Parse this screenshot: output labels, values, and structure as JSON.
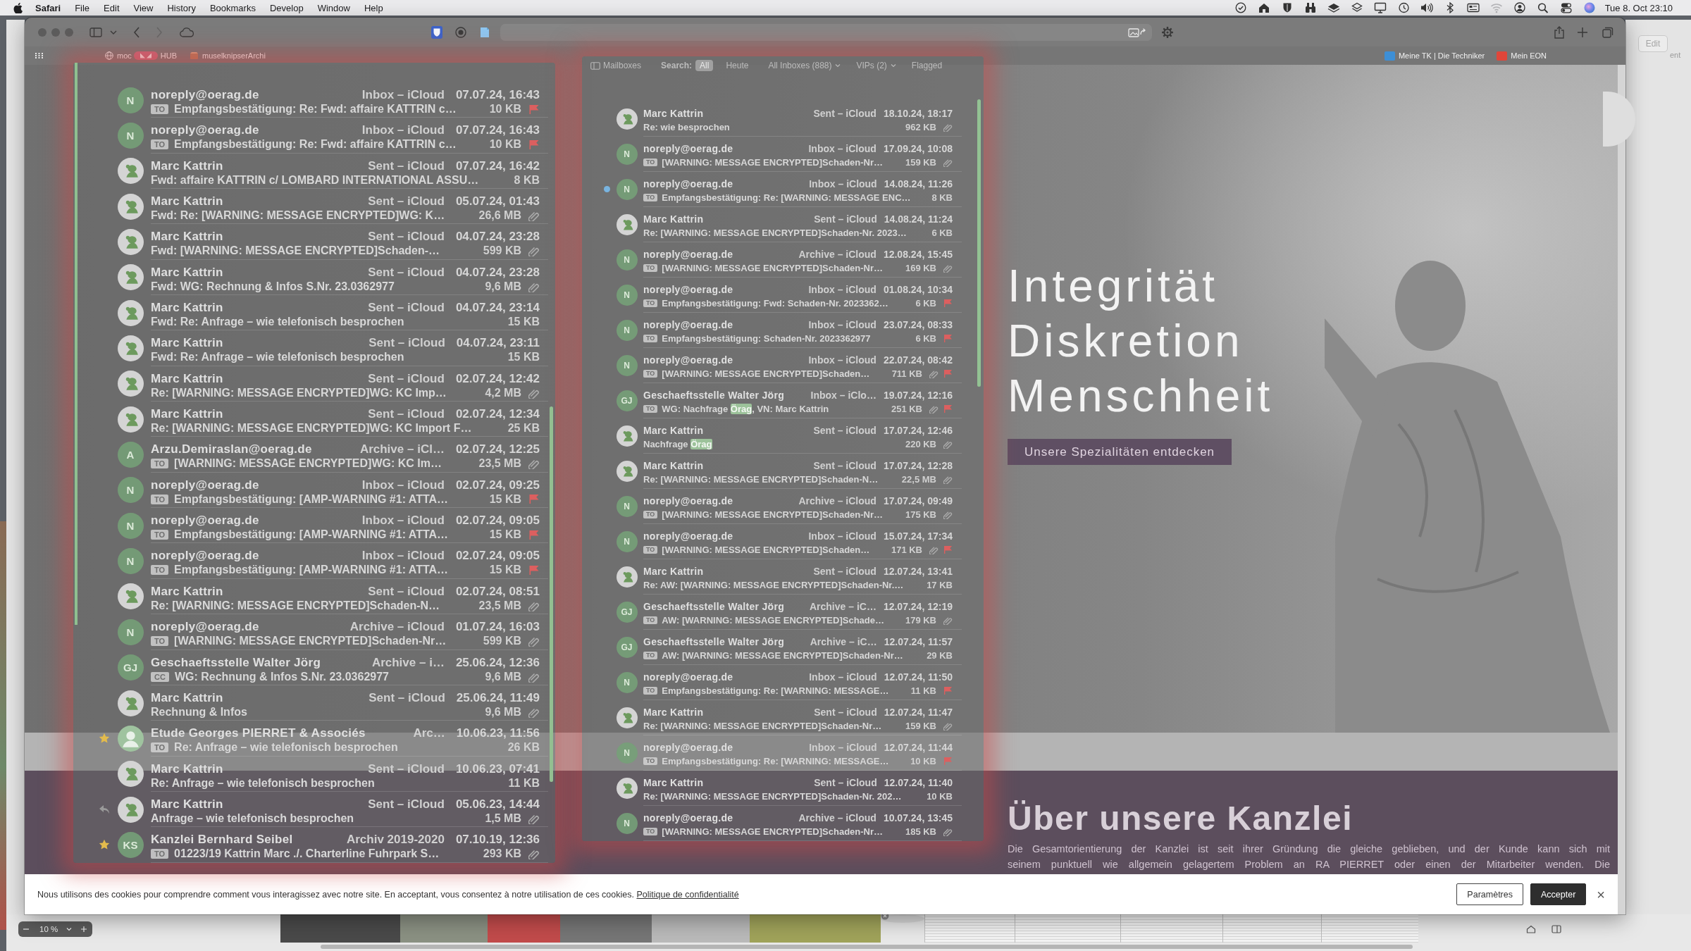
{
  "menu_bar": {
    "app": "Safari",
    "menus": [
      "File",
      "Edit",
      "View",
      "History",
      "Bookmarks",
      "Develop",
      "Window",
      "Help"
    ],
    "clock": "Tue 8. Oct 23:10"
  },
  "safari": {
    "favorites_left": [
      {
        "kind": "globe",
        "label": "moc",
        "suffix": "HUB"
      },
      {
        "kind": "box",
        "label": "muselknipserArchi"
      }
    ],
    "favorites_right": [
      {
        "kind": "tile",
        "label": "Meine TK | Die Techniker",
        "color": "#3d8fd6"
      },
      {
        "kind": "tile",
        "label": "Mein EON",
        "color": "#e0463a"
      }
    ]
  },
  "website": {
    "hero": {
      "lines": [
        "Integrität",
        "Diskretion",
        "Menschheit"
      ],
      "button": "Unsere Spezialitäten entdecken"
    },
    "about": {
      "heading": "Über unsere Kanzlei",
      "lines": [
        "Die Gesamtorientierung der Kanzlei ist seit ihrer Gründung die gleiche geblieben, und der Kunde kann sich mit",
        "seinem punktuell wie allgemein gelagertem Problem an RA PIERRET oder einen der Mitarbeiter wenden. Die"
      ]
    },
    "cookie_banner": {
      "text": "Nous utilisons des cookies pour comprendre comment vous interagissez avec notre site. En acceptant, vous consentez à notre utilisation de ces cookies.",
      "link": "Politique de confidentialité",
      "buttons": [
        {
          "label": "Paramètres",
          "kind": "outline"
        },
        {
          "label": "Accepter",
          "kind": "filled"
        }
      ],
      "close": "×"
    }
  },
  "mail_left": {
    "rows": [
      {
        "avatar": {
          "kind": "initials",
          "text": "N"
        },
        "sender": "noreply@oerag.de",
        "mailbox": "Inbox – iCloud",
        "date": "07.07.24, 16:43",
        "tag": "TO",
        "subject": "Empfangsbestätigung: Re: Fwd: affaire KATTRIN c…",
        "size": "10 KB",
        "attachment": false,
        "flagged": true
      },
      {
        "avatar": {
          "kind": "initials",
          "text": "N"
        },
        "sender": "noreply@oerag.de",
        "mailbox": "Inbox – iCloud",
        "date": "07.07.24, 16:43",
        "tag": "TO",
        "subject": "Empfangsbestätigung: Re: Fwd: affaire KATTRIN c…",
        "size": "10 KB",
        "attachment": false,
        "flagged": true
      },
      {
        "avatar": {
          "kind": "picture"
        },
        "sender": "Marc Kattrin",
        "mailbox": "Sent – iCloud",
        "date": "07.07.24, 16:42",
        "subject": "Fwd: affaire KATTRIN c/ LOMBARD INTERNATIONAL ASSU…",
        "size": "8 KB",
        "attachment": false,
        "flagged": false
      },
      {
        "avatar": {
          "kind": "picture"
        },
        "sender": "Marc Kattrin",
        "mailbox": "Sent – iCloud",
        "date": "05.07.24, 01:43",
        "subject": "Fwd: Re: [WARNING: MESSAGE ENCRYPTED]WG: K…",
        "size": "26,6 MB",
        "attachment": true,
        "flagged": false
      },
      {
        "avatar": {
          "kind": "picture"
        },
        "sender": "Marc Kattrin",
        "mailbox": "Sent – iCloud",
        "date": "04.07.24, 23:28",
        "subject": "Fwd: [WARNING: MESSAGE ENCRYPTED]Schaden-…",
        "size": "599 KB",
        "attachment": true,
        "flagged": false
      },
      {
        "avatar": {
          "kind": "picture"
        },
        "sender": "Marc Kattrin",
        "mailbox": "Sent – iCloud",
        "date": "04.07.24, 23:28",
        "subject": "Fwd: WG: Rechnung & Infos S.Nr. 23.0362977",
        "size": "9,6 MB",
        "attachment": true,
        "flagged": false
      },
      {
        "avatar": {
          "kind": "picture"
        },
        "sender": "Marc Kattrin",
        "mailbox": "Sent – iCloud",
        "date": "04.07.24, 23:14",
        "subject": "Fwd: Re: Anfrage – wie telefonisch besprochen",
        "size": "15 KB",
        "attachment": false,
        "flagged": false
      },
      {
        "avatar": {
          "kind": "picture"
        },
        "sender": "Marc Kattrin",
        "mailbox": "Sent – iCloud",
        "date": "04.07.24, 23:11",
        "subject": "Fwd: Re: Anfrage – wie telefonisch besprochen",
        "size": "15 KB",
        "attachment": false,
        "flagged": false
      },
      {
        "avatar": {
          "kind": "picture"
        },
        "sender": "Marc Kattrin",
        "mailbox": "Sent – iCloud",
        "date": "02.07.24, 12:42",
        "subject": "Re: [WARNING: MESSAGE ENCRYPTED]WG: KC Imp…",
        "size": "4,2 MB",
        "attachment": true,
        "flagged": false
      },
      {
        "avatar": {
          "kind": "picture"
        },
        "sender": "Marc Kattrin",
        "mailbox": "Sent – iCloud",
        "date": "02.07.24, 12:34",
        "subject": "Re: [WARNING: MESSAGE ENCRYPTED]WG: KC Import F…",
        "size": "25 KB",
        "attachment": false,
        "flagged": false
      },
      {
        "avatar": {
          "kind": "initials",
          "text": "A"
        },
        "sender": "Arzu.Demiraslan@oerag.de",
        "mailbox": "Archive – iCl…",
        "date": "02.07.24, 12:25",
        "tag": "TO",
        "subject": "[WARNING: MESSAGE ENCRYPTED]WG: KC Im…",
        "size": "23,5 MB",
        "attachment": true,
        "flagged": false
      },
      {
        "avatar": {
          "kind": "initials",
          "text": "N"
        },
        "sender": "noreply@oerag.de",
        "mailbox": "Inbox – iCloud",
        "date": "02.07.24, 09:25",
        "tag": "TO",
        "subject": "Empfangsbestätigung: [AMP-WARNING #1: ATTA…",
        "size": "15 KB",
        "attachment": false,
        "flagged": true
      },
      {
        "avatar": {
          "kind": "initials",
          "text": "N"
        },
        "sender": "noreply@oerag.de",
        "mailbox": "Inbox – iCloud",
        "date": "02.07.24, 09:05",
        "tag": "TO",
        "subject": "Empfangsbestätigung: [AMP-WARNING #1: ATTA…",
        "size": "15 KB",
        "attachment": false,
        "flagged": true
      },
      {
        "avatar": {
          "kind": "initials",
          "text": "N"
        },
        "sender": "noreply@oerag.de",
        "mailbox": "Inbox – iCloud",
        "date": "02.07.24, 09:05",
        "tag": "TO",
        "subject": "Empfangsbestätigung: [AMP-WARNING #1: ATTA…",
        "size": "15 KB",
        "attachment": false,
        "flagged": true
      },
      {
        "avatar": {
          "kind": "picture"
        },
        "sender": "Marc Kattrin",
        "mailbox": "Sent – iCloud",
        "date": "02.07.24, 08:51",
        "subject": "Re: [WARNING: MESSAGE ENCRYPTED]Schaden-N…",
        "size": "23,5 MB",
        "attachment": true,
        "flagged": false
      },
      {
        "avatar": {
          "kind": "initials",
          "text": "N"
        },
        "sender": "noreply@oerag.de",
        "mailbox": "Archive – iCloud",
        "date": "01.07.24, 16:03",
        "tag": "TO",
        "subject": "[WARNING: MESSAGE ENCRYPTED]Schaden-Nr…",
        "size": "599 KB",
        "attachment": true,
        "flagged": false
      },
      {
        "avatar": {
          "kind": "initials",
          "text": "GJ"
        },
        "sender": "Geschaeftsstelle Walter Jörg",
        "mailbox": "Archive – i…",
        "date": "25.06.24, 12:36",
        "tag": "CC",
        "subject": "WG: Rechnung & Infos S.Nr. 23.0362977",
        "size": "9,6 MB",
        "attachment": true,
        "flagged": false
      },
      {
        "avatar": {
          "kind": "picture"
        },
        "sender": "Marc Kattrin",
        "mailbox": "Sent – iCloud",
        "date": "25.06.24, 11:49",
        "subject": "Rechnung & Infos",
        "size": "9,6 MB",
        "attachment": true,
        "flagged": false
      },
      {
        "marker": {
          "kind": "star"
        },
        "avatar": {
          "kind": "person"
        },
        "sender": "Etude Georges PIERRET & Associés",
        "mailbox": "Arc…",
        "date": "10.06.23, 11:56",
        "tag": "TO",
        "subject": "Re: Anfrage – wie telefonisch besprochen",
        "size": "26 KB",
        "attachment": false,
        "flagged": false
      },
      {
        "avatar": {
          "kind": "picture"
        },
        "sender": "Marc Kattrin",
        "mailbox": "Sent – iCloud",
        "date": "10.06.23, 07:41",
        "subject": "Re: Anfrage – wie telefonisch besprochen",
        "size": "11 KB",
        "attachment": false,
        "flagged": false
      },
      {
        "marker": {
          "kind": "reply"
        },
        "avatar": {
          "kind": "picture"
        },
        "sender": "Marc Kattrin",
        "mailbox": "Sent – iCloud",
        "date": "05.06.23, 14:44",
        "subject": "Anfrage – wie telefonisch besprochen",
        "size": "1,5 MB",
        "attachment": true,
        "flagged": false
      },
      {
        "marker": {
          "kind": "star"
        },
        "avatar": {
          "kind": "initials",
          "text": "KS"
        },
        "sender": "Kanzlei Bernhard Seibel",
        "mailbox": "Archiv 2019-2020",
        "date": "07.10.19, 12:36",
        "tag": "TO",
        "subject": "01223/19 Kattrin Marc ./. Charterline Fuhrpark S…",
        "size": "293 KB",
        "attachment": true,
        "flagged": false
      }
    ]
  },
  "mail_right": {
    "sidebar_button": "Mailboxes",
    "search_label": "Search:",
    "search_scopes": [
      {
        "label": "All",
        "selected": true
      },
      {
        "label": "Heute",
        "selected": false
      }
    ],
    "filters": [
      {
        "label": "All Inboxes (888)",
        "menu": true
      },
      {
        "label": "VIPs (2)",
        "menu": true
      },
      {
        "label": "Flagged",
        "menu": false
      }
    ],
    "rows": [
      {
        "avatar": {
          "kind": "picture"
        },
        "sender": "Marc Kattrin",
        "mailbox": "Sent – iCloud",
        "date": "18.10.24, 18:17",
        "subject": "Re: wie besprochen",
        "size": "962 KB",
        "attachment": true,
        "flagged": false
      },
      {
        "avatar": {
          "kind": "initials",
          "text": "N"
        },
        "sender": "noreply@oerag.de",
        "mailbox": "Inbox – iCloud",
        "date": "17.09.24, 10:08",
        "tag": "TO",
        "subject": "[WARNING: MESSAGE ENCRYPTED]Schaden-Nr…",
        "size": "159 KB",
        "attachment": true,
        "flagged": false
      },
      {
        "marker": {
          "kind": "unread"
        },
        "avatar": {
          "kind": "initials",
          "text": "N"
        },
        "sender": "noreply@oerag.de",
        "mailbox": "Inbox – iCloud",
        "date": "14.08.24, 11:26",
        "tag": "TO",
        "subject": "Empfangsbestätigung: Re: [WARNING: MESSAGE ENC…",
        "size": "8 KB",
        "attachment": false,
        "flagged": false
      },
      {
        "avatar": {
          "kind": "picture"
        },
        "sender": "Marc Kattrin",
        "mailbox": "Sent – iCloud",
        "date": "14.08.24, 11:24",
        "subject": "Re: [WARNING: MESSAGE ENCRYPTED]Schaden-Nr. 2023…",
        "size": "6 KB",
        "attachment": false,
        "flagged": false
      },
      {
        "avatar": {
          "kind": "initials",
          "text": "N"
        },
        "sender": "noreply@oerag.de",
        "mailbox": "Archive – iCloud",
        "date": "12.08.24, 15:45",
        "tag": "TO",
        "subject": "[WARNING: MESSAGE ENCRYPTED]Schaden-Nr…",
        "size": "169 KB",
        "attachment": true,
        "flagged": false
      },
      {
        "avatar": {
          "kind": "initials",
          "text": "N"
        },
        "sender": "noreply@oerag.de",
        "mailbox": "Inbox – iCloud",
        "date": "01.08.24, 10:34",
        "tag": "TO",
        "subject": "Empfangsbestätigung: Fwd: Schaden-Nr. 2023362…",
        "size": "6 KB",
        "attachment": false,
        "flagged": true
      },
      {
        "avatar": {
          "kind": "initials",
          "text": "N"
        },
        "sender": "noreply@oerag.de",
        "mailbox": "Inbox – iCloud",
        "date": "23.07.24, 08:33",
        "tag": "TO",
        "subject": "Empfangsbestätigung: Schaden-Nr. 2023362977",
        "size": "6 KB",
        "attachment": false,
        "flagged": true
      },
      {
        "avatar": {
          "kind": "initials",
          "text": "N"
        },
        "sender": "noreply@oerag.de",
        "mailbox": "Inbox – iCloud",
        "date": "22.07.24, 08:42",
        "tag": "TO",
        "subject": "[WARNING: MESSAGE ENCRYPTED]Schaden…",
        "size": "711 KB",
        "attachment": true,
        "flagged": true
      },
      {
        "avatar": {
          "kind": "initials",
          "text": "GJ"
        },
        "sender": "Geschaeftsstelle Walter Jörg",
        "mailbox": "Inbox – iClo…",
        "date": "19.07.24, 12:16",
        "tag": "TO",
        "subject_parts": [
          {
            "text": "WG: Nachfrage ",
            "highlighted": false
          },
          {
            "text": "Örag",
            "highlighted": true
          },
          {
            "text": ", VN: Marc Kattrin",
            "highlighted": false
          }
        ],
        "size": "251 KB",
        "attachment": true,
        "flagged": true
      },
      {
        "avatar": {
          "kind": "picture"
        },
        "sender": "Marc Kattrin",
        "mailbox": "Sent – iCloud",
        "date": "17.07.24, 12:46",
        "subject_parts": [
          {
            "text": "Nachfrage ",
            "highlighted": false
          },
          {
            "text": "Örag",
            "highlighted": true
          }
        ],
        "size": "220 KB",
        "attachment": true,
        "flagged": false
      },
      {
        "avatar": {
          "kind": "picture"
        },
        "sender": "Marc Kattrin",
        "mailbox": "Sent – iCloud",
        "date": "17.07.24, 12:28",
        "subject": "Re: [WARNING: MESSAGE ENCRYPTED]Schaden-N…",
        "size": "22,5 MB",
        "attachment": true,
        "flagged": false
      },
      {
        "avatar": {
          "kind": "initials",
          "text": "N"
        },
        "sender": "noreply@oerag.de",
        "mailbox": "Archive – iCloud",
        "date": "17.07.24, 09:49",
        "tag": "TO",
        "subject": "[WARNING: MESSAGE ENCRYPTED]Schaden-Nr…",
        "size": "175 KB",
        "attachment": true,
        "flagged": false
      },
      {
        "avatar": {
          "kind": "initials",
          "text": "N"
        },
        "sender": "noreply@oerag.de",
        "mailbox": "Inbox – iCloud",
        "date": "15.07.24, 17:34",
        "tag": "TO",
        "subject": "[WARNING: MESSAGE ENCRYPTED]Schaden…",
        "size": "171 KB",
        "attachment": true,
        "flagged": true
      },
      {
        "avatar": {
          "kind": "picture"
        },
        "sender": "Marc Kattrin",
        "mailbox": "Sent – iCloud",
        "date": "12.07.24, 13:41",
        "subject": "Re: AW: [WARNING: MESSAGE ENCRYPTED]Schaden-Nr.…",
        "size": "17 KB",
        "attachment": false,
        "flagged": false
      },
      {
        "avatar": {
          "kind": "initials",
          "text": "GJ"
        },
        "sender": "Geschaeftsstelle Walter Jörg",
        "mailbox": "Archive – iC…",
        "date": "12.07.24, 12:19",
        "tag": "TO",
        "subject": "AW: [WARNING: MESSAGE ENCRYPTED]Schade…",
        "size": "179 KB",
        "attachment": true,
        "flagged": false
      },
      {
        "avatar": {
          "kind": "initials",
          "text": "GJ"
        },
        "sender": "Geschaeftsstelle Walter Jörg",
        "mailbox": "Archive – iC…",
        "date": "12.07.24, 11:57",
        "tag": "TO",
        "subject": "AW: [WARNING: MESSAGE ENCRYPTED]Schaden-Nr…",
        "size": "29 KB",
        "attachment": false,
        "flagged": false
      },
      {
        "avatar": {
          "kind": "initials",
          "text": "N"
        },
        "sender": "noreply@oerag.de",
        "mailbox": "Inbox – iCloud",
        "date": "12.07.24, 11:50",
        "tag": "TO",
        "subject": "Empfangsbestätigung: Re: [WARNING: MESSAGE…",
        "size": "11 KB",
        "attachment": false,
        "flagged": true
      },
      {
        "avatar": {
          "kind": "picture"
        },
        "sender": "Marc Kattrin",
        "mailbox": "Sent – iCloud",
        "date": "12.07.24, 11:47",
        "subject": "Re: [WARNING: MESSAGE ENCRYPTED]Schaden-Nr…",
        "size": "159 KB",
        "attachment": true,
        "flagged": false
      },
      {
        "avatar": {
          "kind": "initials",
          "text": "N"
        },
        "sender": "noreply@oerag.de",
        "mailbox": "Inbox – iCloud",
        "date": "12.07.24, 11:44",
        "tag": "TO",
        "subject": "Empfangsbestätigung: Re: [WARNING: MESSAGE…",
        "size": "10 KB",
        "attachment": false,
        "flagged": true
      },
      {
        "avatar": {
          "kind": "picture"
        },
        "sender": "Marc Kattrin",
        "mailbox": "Sent – iCloud",
        "date": "12.07.24, 11:40",
        "subject": "Re: [WARNING: MESSAGE ENCRYPTED]Schaden-Nr. 202…",
        "size": "10 KB",
        "attachment": false,
        "flagged": false
      },
      {
        "avatar": {
          "kind": "initials",
          "text": "N"
        },
        "sender": "noreply@oerag.de",
        "mailbox": "Archive – iCloud",
        "date": "10.07.24, 13:45",
        "tag": "TO",
        "subject": "[WARNING: MESSAGE ENCRYPTED]Schaden-Nr…",
        "size": "185 KB",
        "attachment": true,
        "flagged": false
      }
    ]
  },
  "back_window": {
    "edit_button": {
      "label": "Edit",
      "disabled": true
    },
    "cut_text": "ent",
    "zoom_level": "10 %"
  }
}
